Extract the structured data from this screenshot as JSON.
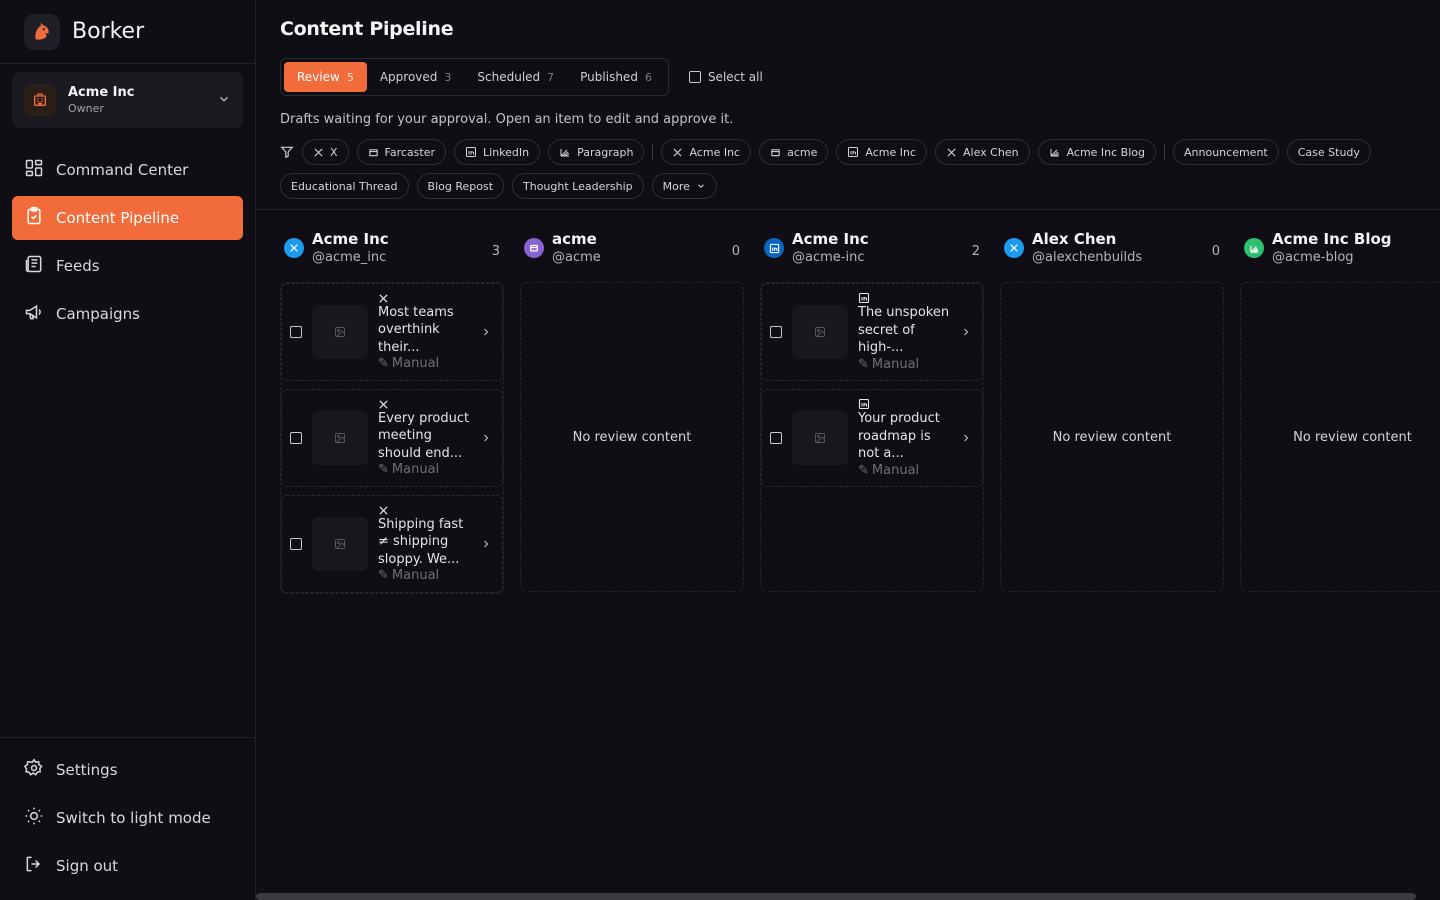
{
  "app": {
    "name": "Borker"
  },
  "org": {
    "name": "Acme Inc",
    "role": "Owner"
  },
  "nav": [
    {
      "label": "Command Center",
      "icon": "grid-icon"
    },
    {
      "label": "Content Pipeline",
      "icon": "clipboard-icon",
      "active": true
    },
    {
      "label": "Feeds",
      "icon": "newspaper-icon"
    },
    {
      "label": "Campaigns",
      "icon": "megaphone-icon"
    }
  ],
  "bottom_nav": [
    {
      "label": "Settings",
      "icon": "gear-icon"
    },
    {
      "label": "Switch to light mode",
      "icon": "sun-icon"
    },
    {
      "label": "Sign out",
      "icon": "logout-icon"
    }
  ],
  "page": {
    "title": "Content Pipeline",
    "subtitle": "Drafts waiting for your approval. Open an item to edit and approve it.",
    "select_all": "Select all"
  },
  "tabs": [
    {
      "label": "Review",
      "count": "5",
      "active": true
    },
    {
      "label": "Approved",
      "count": "3"
    },
    {
      "label": "Scheduled",
      "count": "7"
    },
    {
      "label": "Published",
      "count": "6"
    }
  ],
  "filters": {
    "platforms": [
      "X",
      "Farcaster",
      "LinkedIn",
      "Paragraph"
    ],
    "accounts": [
      "Acme Inc",
      "acme",
      "Acme Inc",
      "Alex Chen",
      "Acme Inc Blog"
    ],
    "types": [
      "Announcement",
      "Case Study",
      "Educational Thread",
      "Blog Repost",
      "Thought Leadership"
    ],
    "more": "More"
  },
  "columns": [
    {
      "name": "Acme Inc",
      "handle": "@acme_inc",
      "count": "3",
      "platform": "x",
      "color": "#1d9bf0",
      "cards": [
        {
          "platform": "x",
          "text": "Most teams overthink their...",
          "source": "Manual"
        },
        {
          "platform": "x",
          "text": "Every product meeting should end...",
          "source": "Manual"
        },
        {
          "platform": "x",
          "text": "Shipping fast ≠ shipping sloppy. We...",
          "source": "Manual"
        }
      ]
    },
    {
      "name": "acme",
      "handle": "@acme",
      "count": "0",
      "platform": "farcaster",
      "color": "#8a63d2",
      "cards": [],
      "empty": "No review content"
    },
    {
      "name": "Acme Inc",
      "handle": "@acme-inc",
      "count": "2",
      "platform": "linkedin",
      "color": "#0a66c2",
      "cards": [
        {
          "platform": "linkedin",
          "text": "The unspoken secret of high-...",
          "source": "Manual"
        },
        {
          "platform": "linkedin",
          "text": "Your product roadmap is not a...",
          "source": "Manual"
        }
      ]
    },
    {
      "name": "Alex Chen",
      "handle": "@alexchenbuilds",
      "count": "0",
      "platform": "x",
      "color": "#1d9bf0",
      "cards": [],
      "empty": "No review content"
    },
    {
      "name": "Acme Inc Blog",
      "handle": "@acme-blog",
      "count": "",
      "platform": "paragraph",
      "color": "#2fbf71",
      "cards": [],
      "empty": "No review content"
    }
  ],
  "colors": {
    "accent": "#f26b3a",
    "background": "#0e0e14"
  }
}
